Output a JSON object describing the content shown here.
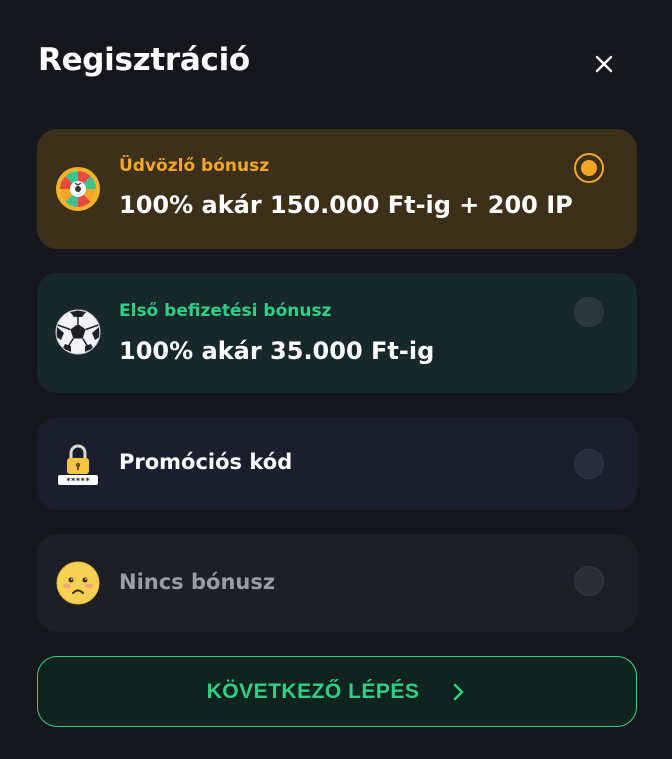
{
  "header": {
    "title": "Regisztráció",
    "close_icon": "close-icon"
  },
  "options": [
    {
      "id": "welcome",
      "icon": "wheel-icon",
      "subtitle": "Üdvözlő bónusz",
      "label": "100% akár 150.000 Ft-ig + 200 IP",
      "selected": true,
      "accent": "#f5a623"
    },
    {
      "id": "first-deposit",
      "icon": "soccer-ball-icon",
      "subtitle": "Első befizetési bónusz",
      "label": "100% akár 35.000 Ft-ig",
      "selected": false,
      "accent": "#2fcf85"
    },
    {
      "id": "promo",
      "icon": "lock-password-icon",
      "label": "Promóciós kód",
      "selected": false
    },
    {
      "id": "none",
      "icon": "sad-face-icon",
      "label": "Nincs bónusz",
      "selected": false
    }
  ],
  "footer": {
    "next_label": "KÖVETKEZŐ LÉPÉS",
    "next_icon": "chevron-right-icon",
    "accent": "#2fcf85"
  }
}
